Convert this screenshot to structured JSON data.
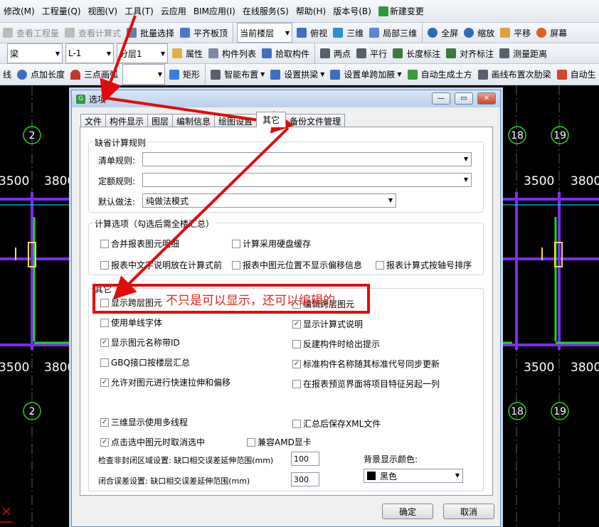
{
  "menu": [
    "修改(M)",
    "工程量(Q)",
    "视图(V)",
    "工具(T)",
    "云应用",
    "BIM应用(I)",
    "在线服务(S)",
    "帮助(H)",
    "版本号(B)",
    "新建变更"
  ],
  "toolbar1": {
    "items": [
      "查看工程量",
      "查看计算式",
      "批量选择",
      "平齐板顶"
    ],
    "floor_combo": "当前楼层",
    "view_items": [
      "俯视",
      "三维",
      "局部三维",
      "全屏",
      "缩放",
      "平移",
      "屏幕"
    ]
  },
  "toolbar2": {
    "combo_type": "梁",
    "combo_name": "L-1",
    "combo_layer": "分层1",
    "items": [
      "属性",
      "构件列表",
      "拾取构件",
      "两点",
      "平行",
      "长度标注",
      "对齐标注",
      "测量距离"
    ]
  },
  "toolbar3": {
    "lead": "线",
    "items": [
      "点加长度",
      "三点画弧",
      "矩形",
      "智能布置",
      "设置拱梁",
      "设置单跨加腋",
      "自动生成土方",
      "画线布置次肋梁",
      "自动生"
    ]
  },
  "cad": {
    "axis_left": [
      "2",
      "2"
    ],
    "axis_right": [
      "18",
      "19",
      "18",
      "19"
    ],
    "dims_left": [
      "3500",
      "3800",
      "3500",
      "3800"
    ],
    "dims_right": [
      "3500",
      "3800",
      "3500",
      "3800"
    ]
  },
  "dialog": {
    "title": "选项",
    "tabs": [
      "文件",
      "构件显示",
      "图层",
      "编制信息",
      "绘图设置",
      "其它",
      "备份文件管理"
    ],
    "active_tab": "其它",
    "group_default": "缺省计算规则",
    "qd_label": "清单规则:",
    "qd_value": "",
    "de_label": "定额规则:",
    "de_value": "",
    "mr_label": "默认做法:",
    "mr_value": "纯做法模式",
    "group_calc": "计算选项（勾选后需全楼汇总）",
    "calc_options": [
      {
        "label": "合并报表图元明细",
        "checked": false
      },
      {
        "label": "计算采用硬盘缓存",
        "checked": false
      },
      {
        "label": "报表中文字说明放在计算式前",
        "checked": false
      },
      {
        "label": "报表中图元位置不显示偏移信息",
        "checked": false
      },
      {
        "label": "报表计算式按轴号排序",
        "checked": false
      }
    ],
    "group_other": "其它",
    "other_left": [
      {
        "label": "显示跨层图元",
        "checked": false
      },
      {
        "label": "使用单线字体",
        "checked": false
      },
      {
        "label": "显示图元名称带ID",
        "checked": true
      },
      {
        "label": "GBQ接口按楼层汇总",
        "checked": false
      },
      {
        "label": "允许对图元进行快速拉伸和偏移",
        "checked": true
      },
      {
        "label": "三维显示使用多线程",
        "checked": true
      },
      {
        "label": "点击选中图元时取消选中",
        "checked": true
      }
    ],
    "other_right": [
      {
        "label": "编辑跨层图元",
        "checked": false
      },
      {
        "label": "显示计算式说明",
        "checked": true
      },
      {
        "label": "反建构件时给出提示",
        "checked": false
      },
      {
        "label": "标准构件名称随其标准代号同步更新",
        "checked": true
      },
      {
        "label": "在报表预览界面将项目特征另起一列",
        "checked": false
      },
      {
        "label": "汇总后保存XML文件",
        "checked": false
      },
      {
        "label": "兼容AMD显卡",
        "checked": false
      }
    ],
    "check_label": "检查非封闭区域设置: 缺口相交误差延伸范围(mm)",
    "check_value": "100",
    "close_label": "闭合误差设置: 缺口相交误差延伸范围(mm)",
    "close_value": "300",
    "bg_label": "背景显示颜色:",
    "bg_value": "黑色",
    "ok": "确定",
    "cancel": "取消"
  },
  "annotation": "不只是可以显示，还可以编辑的",
  "colors": {
    "arrow": "#e30b0b",
    "axis_cyan": "#00ffff",
    "beam_purple": "#7b2cff",
    "slab_green": "#25d22b"
  }
}
